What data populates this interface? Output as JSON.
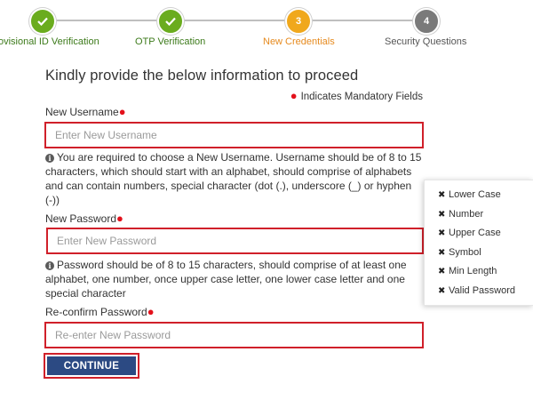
{
  "stepper": {
    "steps": [
      {
        "number": "",
        "label": "ovisional ID Verification",
        "status": "done",
        "icon": "check-icon"
      },
      {
        "number": "",
        "label": "OTP Verification",
        "status": "done",
        "icon": "check-icon"
      },
      {
        "number": "3",
        "label": "New Credentials",
        "status": "active"
      },
      {
        "number": "4",
        "label": "Security Questions",
        "status": "todo"
      }
    ]
  },
  "form": {
    "heading": "Kindly provide the below information to proceed",
    "mandatory_note": "Indicates Mandatory Fields",
    "username": {
      "label": "New Username",
      "placeholder": "Enter New Username",
      "value": "",
      "help": "You are required to choose a New Username. Username should be of 8 to 15 characters, which should start with an alphabet, should comprise of alphabets and can contain numbers, special character (dot (.), underscore (_) or hyphen (-))"
    },
    "password": {
      "label": "New Password",
      "placeholder": "Enter New Password",
      "value": "",
      "help": "Password should be of 8 to 15 characters, should comprise of at least one alphabet, one number, once upper case letter, one lower case letter and one special character"
    },
    "confirm": {
      "label": "Re-confirm Password",
      "placeholder": "Re-enter New Password",
      "value": ""
    },
    "continue_label": "CONTINUE"
  },
  "password_rules": [
    {
      "label": "Lower Case",
      "icon": "x-icon"
    },
    {
      "label": "Number",
      "icon": "x-icon"
    },
    {
      "label": "Upper Case",
      "icon": "x-icon"
    },
    {
      "label": "Symbol",
      "icon": "x-icon"
    },
    {
      "label": "Min Length",
      "icon": "x-icon"
    },
    {
      "label": "Valid Password",
      "icon": "x-icon"
    }
  ],
  "colors": {
    "done": "#6aac1e",
    "active": "#f0a81c",
    "todo": "#7a7a7a",
    "required": "#e3111b",
    "highlight_border": "#d0202a",
    "button": "#2c4a83"
  }
}
